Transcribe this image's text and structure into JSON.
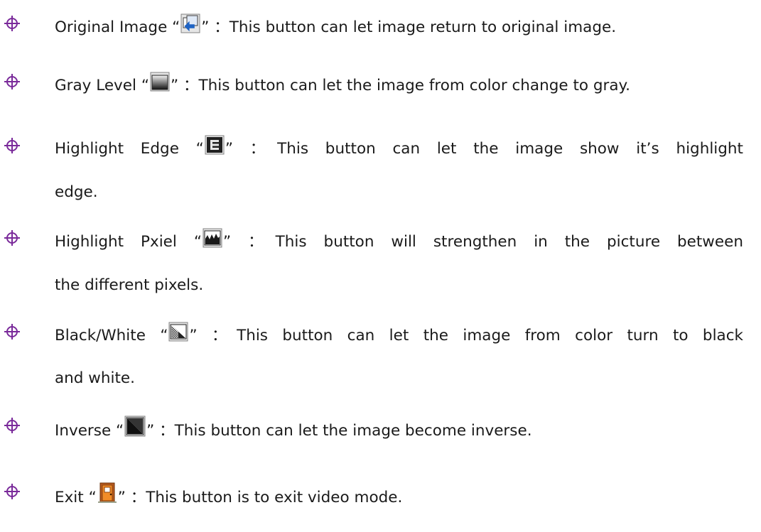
{
  "items": [
    {
      "label": "Original Image",
      "icon": "original-image-icon",
      "desc": "This button can let image return to original image.",
      "cont": ""
    },
    {
      "label": "Gray Level",
      "icon": "gray-level-icon",
      "desc": "This button can let the image from color change to gray.",
      "cont": ""
    },
    {
      "label": "Highlight Edge",
      "icon": "highlight-edge-icon",
      "desc": "This button can let the image show it’s highlight",
      "cont": "edge."
    },
    {
      "label": "Highlight Pxiel",
      "icon": "highlight-pixel-icon",
      "desc": "This button will strengthen in the picture between",
      "cont": "the different pixels."
    },
    {
      "label": "Black/White",
      "icon": "black-white-icon",
      "desc": "This button can let the image from color turn to black",
      "cont": "and white."
    },
    {
      "label": "Inverse",
      "icon": "inverse-icon",
      "desc": "This button can let the image become inverse.",
      "cont": ""
    },
    {
      "label": "Exit",
      "icon": "exit-door-icon",
      "desc": "This button is to exit video mode.",
      "cont": ""
    }
  ],
  "bullet_icon": "crosshair-bullet-icon",
  "bullet_color": "#7a2a9a",
  "quote_open": "“",
  "quote_close": "”",
  "separator": "："
}
